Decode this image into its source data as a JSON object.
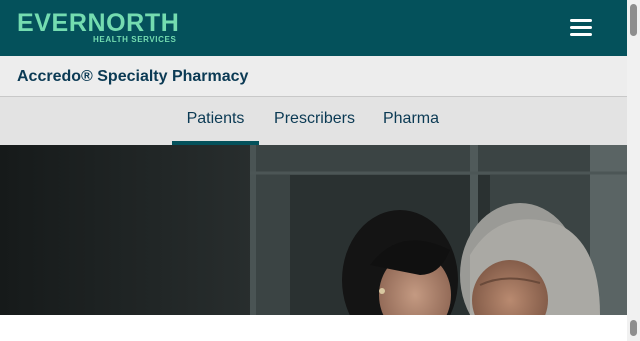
{
  "header": {
    "logo_word": "EVERNORTH",
    "logo_sub": "HEALTH SERVICES",
    "menu_icon": "hamburger-menu-icon"
  },
  "brand": {
    "title": "Accredo® Specialty Pharmacy"
  },
  "tabs": [
    {
      "label": "Patients",
      "active": true
    },
    {
      "label": "Prescribers",
      "active": false
    },
    {
      "label": "Pharma",
      "active": false
    }
  ],
  "hero": {
    "image": "two-women-embracing-photo"
  },
  "banner": {
    "text": ""
  },
  "colors": {
    "header_bg": "#04515b",
    "logo": "#74dcb0",
    "brand_bar_bg": "#ededed",
    "tabs_bg": "#e3e3e3",
    "text_dark": "#0b3a54"
  }
}
